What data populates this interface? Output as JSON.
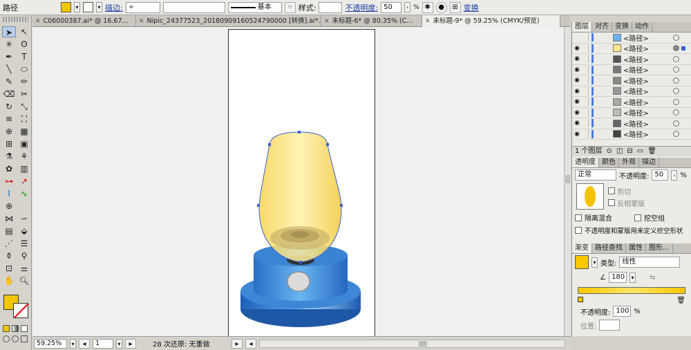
{
  "control_bar": {
    "selection_label": "路径",
    "stroke_label": "描边:",
    "stroke_style": "基本",
    "style_label": "样式:",
    "opacity_label": "不透明度:",
    "opacity_value": "50",
    "opacity_unit": "%",
    "transform_label": "变换"
  },
  "doc_tabs": [
    {
      "label": "C06000387.ai* @ 16.67..."
    },
    {
      "label": "Nipic_24377523_20180909160524790000 [转换].ai*..."
    },
    {
      "label": "未标题-6* @ 80.35% (C..."
    },
    {
      "label": "未标题-9* @ 59.25% (CMYK/预览)"
    }
  ],
  "status_bar": {
    "zoom": "59.25%",
    "page": "1",
    "undo_text": "28 次还原: 无重做"
  },
  "layers_panel": {
    "tabs": [
      "图层",
      "对齐",
      "变换",
      "动作"
    ],
    "rows": [
      "<路径>",
      "<路径>",
      "<路径>",
      "<路径>",
      "<路径>",
      "<路径>",
      "<路径>",
      "<路径>",
      "<路径>",
      "<路径>"
    ],
    "footer": "1 个图层"
  },
  "transparency_panel": {
    "tabs": [
      "透明度",
      "颜色",
      "外观",
      "描边"
    ],
    "blend_mode": "正常",
    "opacity_label": "不透明度:",
    "opacity_value": "50",
    "opacity_unit": "%",
    "clip_label": "剪切",
    "invert_label": "反相蒙版",
    "isolate_label": "隔离混合",
    "knockout_label": "挖空组",
    "define_label": "不透明度和蒙版用来定义挖空形状"
  },
  "gradient_panel": {
    "tabs": [
      "渐变",
      "路径查找",
      "属性",
      "图形..."
    ],
    "type_label": "类型:",
    "type_value": "线性",
    "angle_value": "180",
    "opacity_label": "不透明度:",
    "opacity_value": "100",
    "location_label": "位置:"
  },
  "colors": {
    "fill": "#f2c700",
    "accent_blue": "#2b73c9",
    "selection": "#3a5fd0"
  }
}
